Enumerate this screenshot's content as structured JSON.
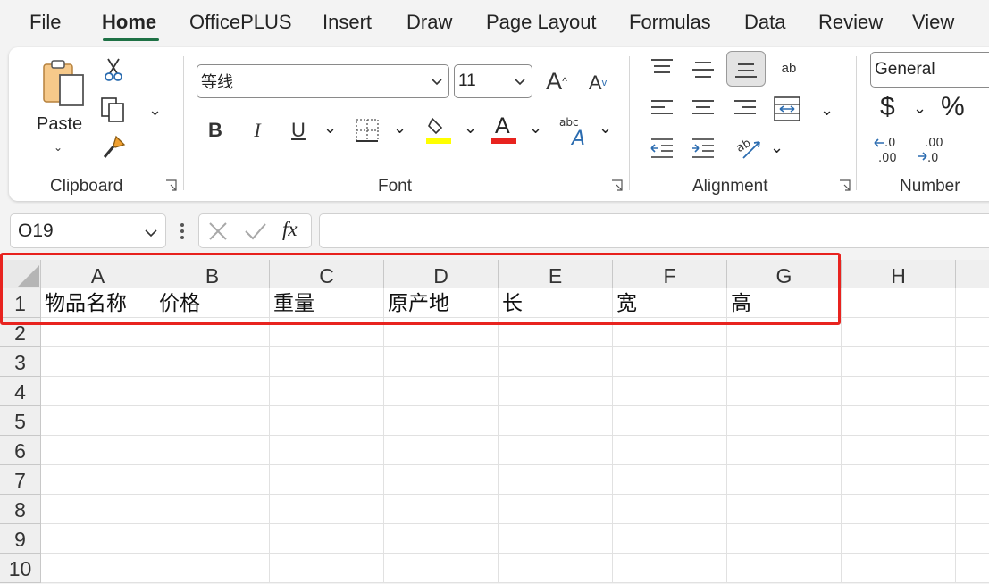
{
  "menu": {
    "tabs": [
      {
        "label": "File"
      },
      {
        "label": "Home"
      },
      {
        "label": "OfficePLUS"
      },
      {
        "label": "Insert"
      },
      {
        "label": "Draw"
      },
      {
        "label": "Page Layout"
      },
      {
        "label": "Formulas"
      },
      {
        "label": "Data"
      },
      {
        "label": "Review"
      },
      {
        "label": "View"
      }
    ],
    "active_tab": "Home",
    "accent_color": "#1e7145"
  },
  "ribbon": {
    "clipboard": {
      "paste_label": "Paste",
      "group_label": "Clipboard"
    },
    "font": {
      "font_name": "等线",
      "font_size": "11",
      "bold_label": "B",
      "italic_label": "I",
      "underline_label": "U",
      "font_color_letter": "A",
      "group_label": "Font",
      "fill_color": "#ffff00",
      "font_color": "#e8231f"
    },
    "alignment": {
      "wrap_text_label": "ab",
      "group_label": "Alignment"
    },
    "number": {
      "format": "General",
      "currency_symbol": "$",
      "percent_symbol": "%",
      "group_label": "Number"
    }
  },
  "formula_bar": {
    "name_box": "O19",
    "fx_label": "fx",
    "formula": ""
  },
  "sheet": {
    "columns": [
      "A",
      "B",
      "C",
      "D",
      "E",
      "F",
      "G",
      "H"
    ],
    "rows": [
      "1",
      "2",
      "3",
      "4",
      "5",
      "6",
      "7",
      "8",
      "9",
      "10"
    ],
    "row1": [
      "物品名称",
      "价格",
      "重量",
      "原产地",
      "长",
      "宽",
      "高",
      ""
    ],
    "highlight_color": "#e8231f"
  }
}
